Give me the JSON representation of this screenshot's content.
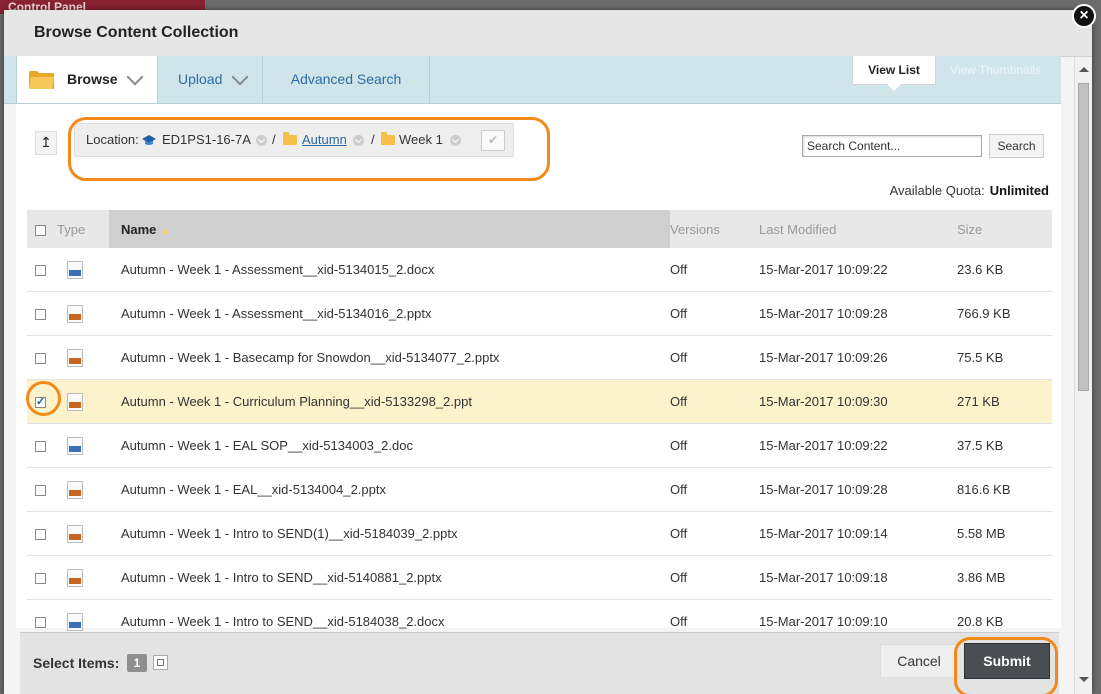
{
  "background": {
    "control_panel": "Control Panel"
  },
  "dialog": {
    "title": "Browse Content Collection",
    "close_label": "×"
  },
  "tabs": {
    "browse": "Browse",
    "upload": "Upload",
    "advanced_search": "Advanced Search",
    "view_list": "View List",
    "view_thumbnails": "View Thumbnails"
  },
  "location": {
    "label": "Location:",
    "crumbs": [
      "ED1PS1-16-7A",
      "Autumn",
      "Week 1"
    ],
    "separator": "/"
  },
  "search": {
    "value": "Search Content...",
    "button": "Search"
  },
  "quota": {
    "label": "Available Quota:",
    "value": "Unlimited"
  },
  "table": {
    "headers": {
      "type": "Type",
      "name": "Name",
      "versions": "Versions",
      "modified": "Last Modified",
      "size": "Size"
    },
    "sort_indicator": "▲",
    "rows": [
      {
        "name": "Autumn - Week 1 - Assessment__xid-5134015_2.docx",
        "type": "docx",
        "versions": "Off",
        "modified": "15-Mar-2017 10:09:22",
        "size": "23.6 KB",
        "checked": false
      },
      {
        "name": "Autumn - Week 1 - Assessment__xid-5134016_2.pptx",
        "type": "pptx",
        "versions": "Off",
        "modified": "15-Mar-2017 10:09:28",
        "size": "766.9 KB",
        "checked": false
      },
      {
        "name": "Autumn - Week 1 - Basecamp for Snowdon__xid-5134077_2.pptx",
        "type": "pptx",
        "versions": "Off",
        "modified": "15-Mar-2017 10:09:26",
        "size": "75.5 KB",
        "checked": false
      },
      {
        "name": "Autumn - Week 1 - Curriculum Planning__xid-5133298_2.ppt",
        "type": "ppt",
        "versions": "Off",
        "modified": "15-Mar-2017 10:09:30",
        "size": "271 KB",
        "checked": true
      },
      {
        "name": "Autumn - Week 1 - EAL SOP__xid-5134003_2.doc",
        "type": "doc",
        "versions": "Off",
        "modified": "15-Mar-2017 10:09:22",
        "size": "37.5 KB",
        "checked": false
      },
      {
        "name": "Autumn - Week 1 - EAL__xid-5134004_2.pptx",
        "type": "pptx",
        "versions": "Off",
        "modified": "15-Mar-2017 10:09:28",
        "size": "816.6 KB",
        "checked": false
      },
      {
        "name": "Autumn - Week 1 - Intro to SEND(1)__xid-5184039_2.pptx",
        "type": "pptx",
        "versions": "Off",
        "modified": "15-Mar-2017 10:09:14",
        "size": "5.58 MB",
        "checked": false
      },
      {
        "name": "Autumn - Week 1 - Intro to SEND__xid-5140881_2.pptx",
        "type": "pptx",
        "versions": "Off",
        "modified": "15-Mar-2017 10:09:18",
        "size": "3.86 MB",
        "checked": false
      },
      {
        "name": "Autumn - Week 1 - Intro to SEND__xid-5184038_2.docx",
        "type": "docx",
        "versions": "Off",
        "modified": "15-Mar-2017 10:09:10",
        "size": "20.8 KB",
        "checked": false
      }
    ]
  },
  "footer": {
    "select_items_label": "Select Items:",
    "select_count": "1",
    "cancel": "Cancel",
    "submit": "Submit"
  },
  "colors": {
    "highlight": "#f28a1a",
    "selected_row": "#fcf3cc",
    "tab_bar": "#cfe5ea",
    "submit": "#4a4d52"
  }
}
